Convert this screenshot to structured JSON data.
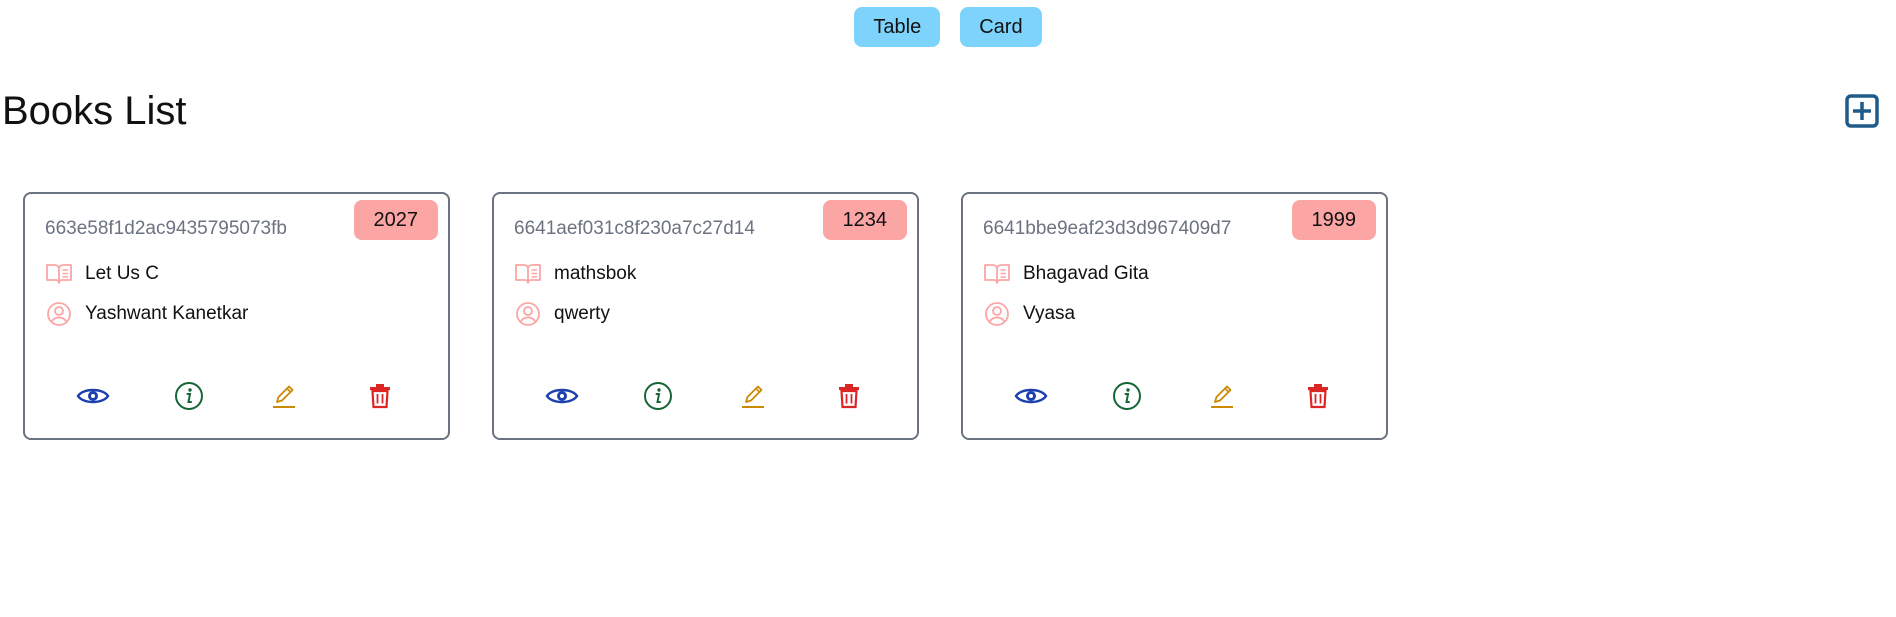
{
  "toggle": {
    "table_label": "Table",
    "card_label": "Card"
  },
  "header": {
    "title": "Books List",
    "add_icon": "plus-square-icon"
  },
  "colors": {
    "toggle_bg": "#7dd3fc",
    "badge_bg": "#fca5a5",
    "view": "#1e40af",
    "info": "#166534",
    "edit": "#ca8a04",
    "delete": "#dc2626",
    "add": "#1e5b8a",
    "meta_icon": "#fca5a5"
  },
  "books": [
    {
      "id": "663e58f1d2ac9435795073fb",
      "year": "2027",
      "title": "Let Us C",
      "author": "Yashwant Kanetkar"
    },
    {
      "id": "6641aef031c8f230a7c27d14",
      "year": "1234",
      "title": "mathsbok",
      "author": "qwerty"
    },
    {
      "id": "6641bbe9eaf23d3d967409d7",
      "year": "1999",
      "title": "Bhagavad Gita",
      "author": "Vyasa"
    }
  ]
}
